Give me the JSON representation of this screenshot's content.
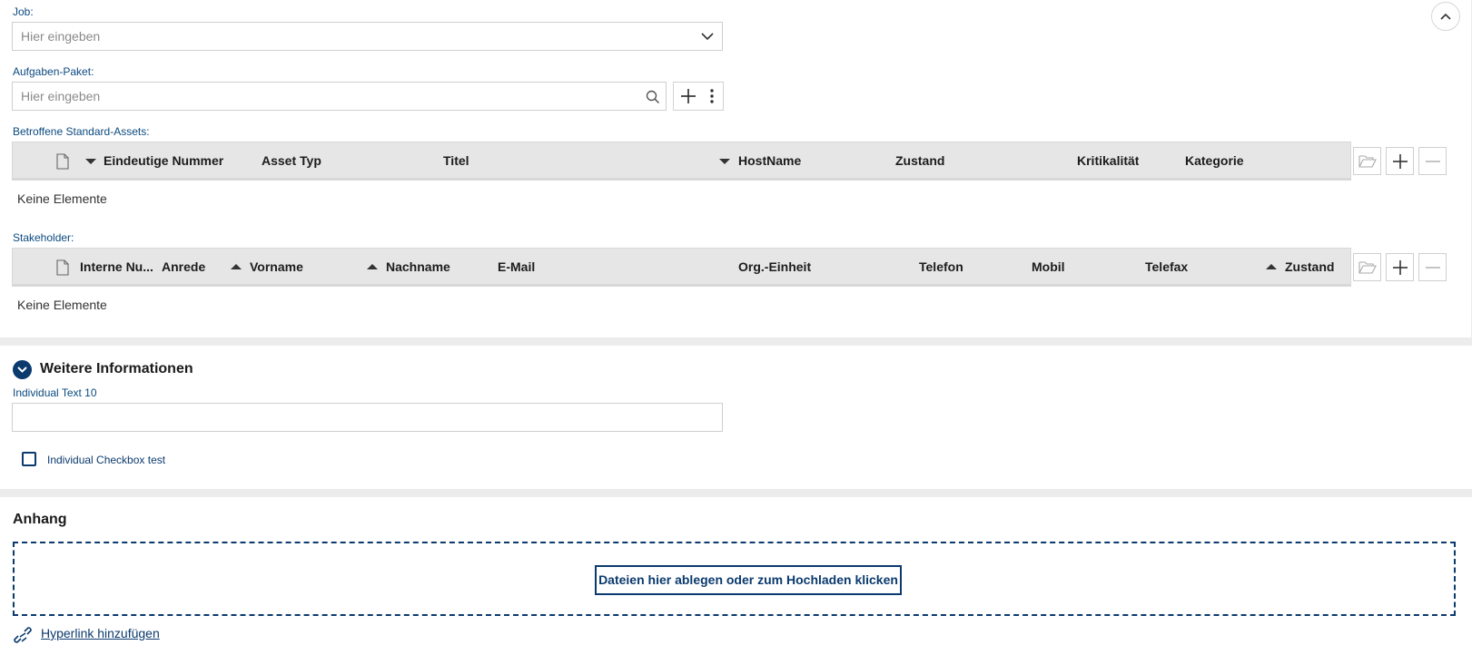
{
  "job": {
    "label": "Job:",
    "placeholder": "Hier eingeben"
  },
  "aufgaben_paket": {
    "label": "Aufgaben-Paket:",
    "placeholder": "Hier eingeben"
  },
  "assets": {
    "label": "Betroffene Standard-Assets:",
    "columns": [
      "Eindeutige Nummer",
      "Asset Typ",
      "Titel",
      "HostName",
      "Zustand",
      "Kritikalität",
      "Kategorie"
    ],
    "empty_text": "Keine Elemente"
  },
  "stakeholder": {
    "label": "Stakeholder:",
    "columns": [
      "Interne Nu...",
      "Anrede",
      "Vorname",
      "Nachname",
      "E-Mail",
      "Org.-Einheit",
      "Telefon",
      "Mobil",
      "Telefax",
      "Zustand"
    ],
    "empty_text": "Keine Elemente"
  },
  "weitere": {
    "title": "Weitere Informationen",
    "text_label": "Individual Text 10",
    "text_value": "",
    "checkbox_label": "Individual Checkbox test",
    "checkbox_checked": false
  },
  "anhang": {
    "title": "Anhang",
    "upload_label": "Dateien hier ablegen oder zum Hochladen klicken",
    "hyperlink_label": "Hyperlink hinzufügen"
  },
  "colors": {
    "accent": "#0b3a6e",
    "label": "#0b4a80",
    "header_bg": "#e6e6e6"
  }
}
